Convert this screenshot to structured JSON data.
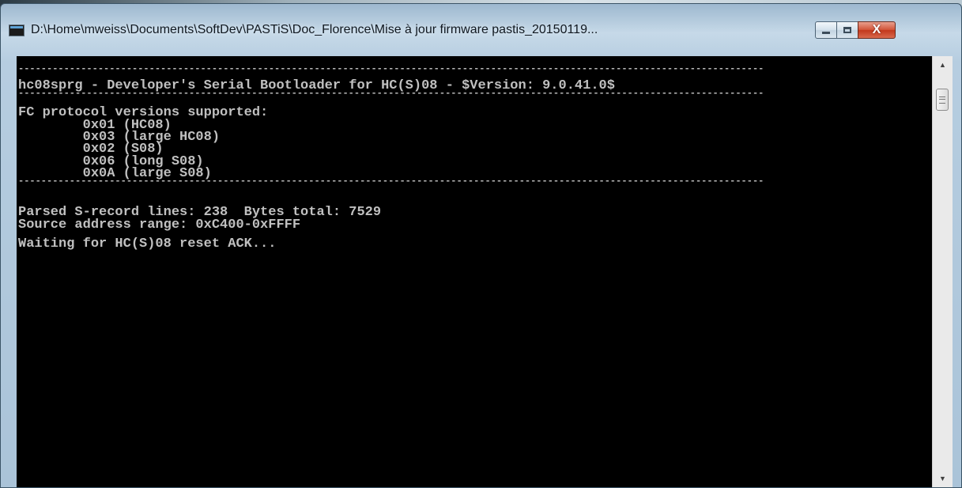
{
  "window": {
    "title": "D:\\Home\\mweiss\\Documents\\SoftDev\\PASTiS\\Doc_Florence\\Mise à jour firmware pastis_20150119...",
    "controls": {
      "minimize": "minimize",
      "maximize": "maximize",
      "close": "X"
    }
  },
  "console": {
    "lines": [
      "-----------------------------------------------------------------------------------------------------------------------------------",
      "hc08sprg - Developer's Serial Bootloader for HC(S)08 - $Version: 9.0.41.0$",
      "-----------------------------------------------------------------------------------------------------------------------------------",
      "FC protocol versions supported:",
      "        0x01 (HC08)",
      "        0x03 (large HC08)",
      "        0x02 (S08)",
      "        0x06 (long S08)",
      "        0x0A (large S08)",
      "-----------------------------------------------------------------------------------------------------------------------------------",
      "",
      "Parsed S-record lines: 238  Bytes total: 7529",
      "Source address range: 0xC400-0xFFFF",
      "",
      "Waiting for HC(S)08 reset ACK..."
    ]
  },
  "scrollbar": {
    "up_icon": "triangle-up",
    "down_icon": "triangle-down"
  }
}
